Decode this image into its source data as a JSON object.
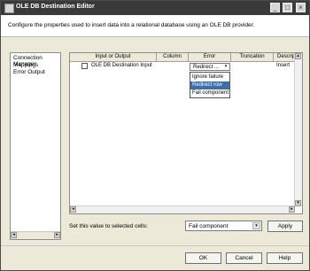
{
  "window": {
    "title": "OLE DB Destination Editor",
    "controls": [
      "_",
      "□",
      "×"
    ]
  },
  "description": "Configure the properties used to insert data into a relational database using an OLE DB provider.",
  "nav": {
    "items": [
      "Connection Manager",
      "Mappings",
      "Error Output"
    ],
    "scroll_left": "◂",
    "scroll_right": "▸"
  },
  "grid": {
    "columns": [
      "Input or Output",
      "Column",
      "Error",
      "Truncation",
      "Description"
    ],
    "rows": [
      {
        "input_output": "OLE DB Destination Input",
        "column": "",
        "error": "Redirect ...",
        "truncation": "",
        "description": "Insert"
      }
    ],
    "error_options": [
      "Ignore failure",
      "Redirect row",
      "Fail component"
    ],
    "selected_option_index": 1,
    "dropdown_arrow": "▾",
    "scroll_up": "▴",
    "scroll_down": "▾",
    "scroll_left": "◂",
    "scroll_right": "▸"
  },
  "set_value": {
    "label": "Set this value to selected cells:",
    "value": "Fail component",
    "apply": "Apply",
    "arrow": "▾"
  },
  "footer": {
    "ok": "OK",
    "cancel": "Cancel",
    "help": "Help"
  },
  "colors": {
    "titlebar": "#3a3a3a",
    "selected": "#3c6ea8",
    "dialog_bg": "#ece9d8"
  }
}
